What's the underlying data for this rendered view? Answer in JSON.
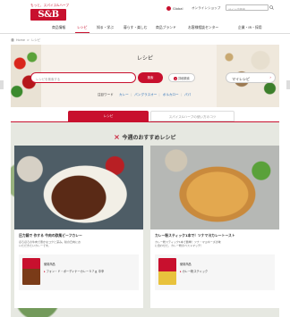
{
  "header": {
    "tagline": "もっと、スパイス&ハーブ",
    "logo": "S&B",
    "global": "Global",
    "online_shop": "オンラインショップ",
    "search_placeholder": "サイト内検索"
  },
  "nav": {
    "items": [
      "商品情報",
      "レシピ",
      "知る・学ぶ",
      "暮らす・楽しむ",
      "商品ブランド",
      "お客様相談センター",
      "企業・IR・採用"
    ]
  },
  "breadcrumb": {
    "home": "Home",
    "current": "レシピ"
  },
  "hero": {
    "title": "レシピ",
    "search_placeholder": "レシピを検索する",
    "search_button": "検索",
    "detail_button": "詳細検索",
    "my_recipe": "マイレシピ",
    "hot_label": "注目ワード",
    "hot_words": [
      "カレー",
      "パングラスオー",
      "ポルカロー",
      "パパ"
    ]
  },
  "tabs": {
    "active": "レシピ",
    "inactive": "スパイス&ハーブの使い方のコツ"
  },
  "reco": {
    "title": "今週のおすすめレシピ",
    "cards": [
      {
        "caption": "圧力鍋で 作する 牛肉の欧風ビーフカレー",
        "desc_1": "ほろほろの牛肉で豊かなコクと深み。秋の日向にお",
        "desc_2": "いただきたいカレーです。",
        "product_label": "使用商品",
        "product_name": "フォン・ド・ボーディナーカレー５７ｇ 中辛"
      },
      {
        "caption": "カレー粉スティック1本で！ツナマヨカレートースト",
        "desc_1": "カレー粉スティック1本で簡単！ツナ・マヨネーズの味",
        "desc_2": "に合わせた、カレー粉のベストマッチ！",
        "product_label": "使用商品",
        "product_name": "カレー粉スティック"
      }
    ]
  }
}
